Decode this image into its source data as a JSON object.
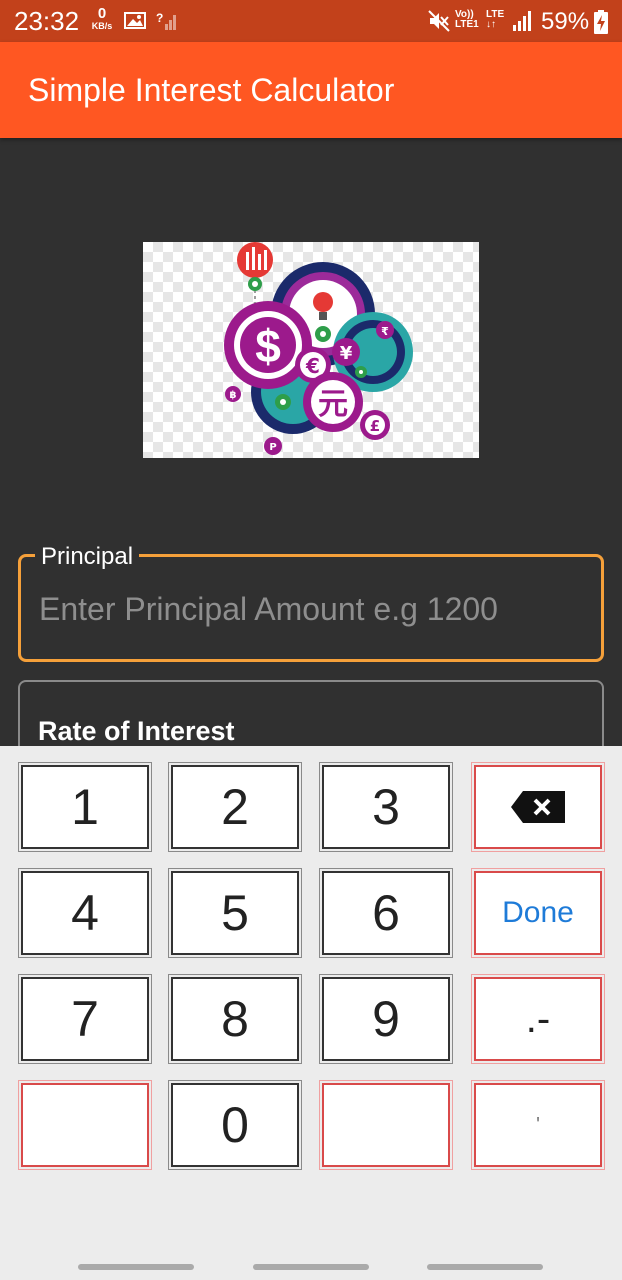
{
  "status_bar": {
    "time": "23:32",
    "net_speed_value": "0",
    "net_speed_unit": "KB/s",
    "volte_line1": "Vo))",
    "volte_line2": "LTE1",
    "lte_label": "LTE",
    "battery_percent": "59%",
    "icons": [
      "gallery-icon",
      "signal-unknown-icon",
      "mute-icon",
      "volte-icon",
      "lte-icon",
      "signal-bars-icon",
      "battery-charging-icon"
    ]
  },
  "app_bar": {
    "title": "Simple Interest Calculator"
  },
  "logo": {
    "icon": "finance-gears-logo",
    "symbols": [
      "$",
      "€",
      "¥",
      "元",
      "£",
      "₹",
      "฿",
      "P"
    ]
  },
  "form": {
    "principal": {
      "label": "Principal",
      "placeholder": "Enter Principal Amount e.g 1200"
    },
    "rate": {
      "label": "Rate of Interest"
    }
  },
  "keypad": {
    "keys": [
      "1",
      "2",
      "3",
      "4",
      "5",
      "6",
      "7",
      "8",
      "9",
      "0"
    ],
    "backspace_icon": "backspace-icon",
    "done_label": "Done",
    "decimal_label": ".-",
    "quote_label": "'"
  },
  "colors": {
    "status_bar": "#c2411b",
    "app_bar": "#ff5722",
    "background": "#303030",
    "focused_border": "#f5a03a",
    "keypad_bg": "#ececec",
    "done_text": "#1e7bd8"
  }
}
